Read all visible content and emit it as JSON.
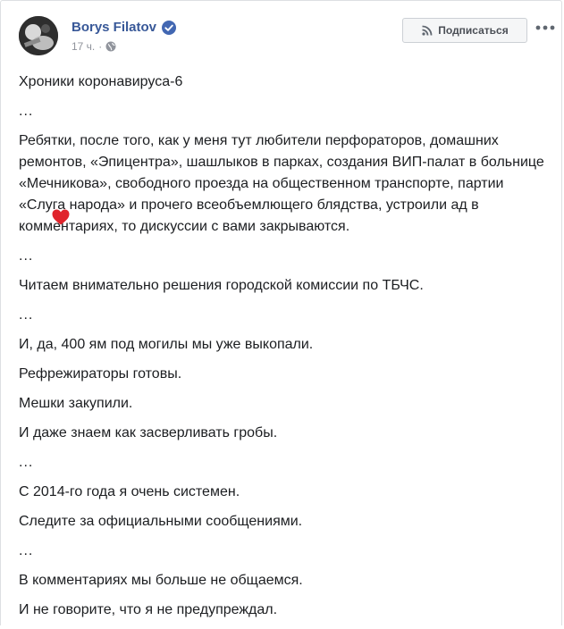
{
  "post": {
    "author": "Borys Filatov",
    "time": "17 ч.",
    "follow_label": "Подписаться",
    "paragraphs": [
      "Хроники коронавируса-6",
      "...",
      "Ребятки, после того, как у меня тут любители перфораторов, домашних ремонтов, «Эпицентра», шашлыков в парках, создания ВИП-палат в больнице «Мечникова», свободного проезда на общественном транспорте, партии «Слуга народа» и прочего всеобъемлющего блядства, устроили ад в комментариях, то дискуссии с вами закрываются.",
      "...",
      "Читаем внимательно решения городской комиссии по ТБЧС.",
      "...",
      "И, да, 400 ям под могилы мы уже выкопали.",
      "Рефрежираторы готовы.",
      "Мешки закупили.",
      "И даже знаем как засверливать гробы.",
      "...",
      "С 2014-го года я очень системен.",
      "Следите за официальными сообщениями.",
      "...",
      "В комментариях мы больше не общаемся.",
      "И не говорите, что я не предупреждал."
    ]
  },
  "icons": {
    "verified": "verified-badge-icon",
    "audience": "globe-icon",
    "follow": "rss-icon",
    "more": "more-dots-icon",
    "censor": "heart-sticker-icon"
  },
  "colors": {
    "author": "#385898",
    "verified": "#4267b2",
    "text": "#1c1e21",
    "meta": "#90949c",
    "censor": "#e0242c"
  }
}
